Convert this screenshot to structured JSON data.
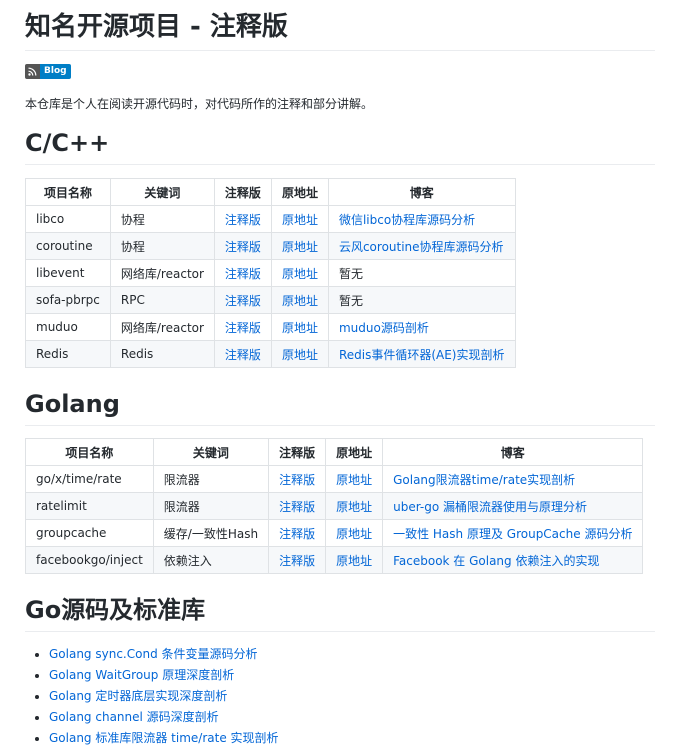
{
  "page": {
    "title": "知名开源项目 - 注释版",
    "badge_label": "Blog",
    "intro": "本仓库是个人在阅读开源代码时，对代码所作的注释和部分讲解。"
  },
  "sections": {
    "cpp": {
      "heading": "C/C++",
      "headers": [
        "项目名称",
        "关键词",
        "注释版",
        "原地址",
        "博客"
      ],
      "rows": [
        [
          "libco",
          "协程",
          "注释版",
          "原地址",
          "微信libco协程库源码分析"
        ],
        [
          "coroutine",
          "协程",
          "注释版",
          "原地址",
          "云风coroutine协程库源码分析"
        ],
        [
          "libevent",
          "网络库/reactor",
          "注释版",
          "原地址",
          "暂无"
        ],
        [
          "sofa-pbrpc",
          "RPC",
          "注释版",
          "原地址",
          "暂无"
        ],
        [
          "muduo",
          "网络库/reactor",
          "注释版",
          "原地址",
          "muduo源码剖析"
        ],
        [
          "Redis",
          "Redis",
          "注释版",
          "原地址",
          "Redis事件循环器(AE)实现剖析"
        ]
      ]
    },
    "golang": {
      "heading": "Golang",
      "headers": [
        "项目名称",
        "关键词",
        "注释版",
        "原地址",
        "博客"
      ],
      "rows": [
        [
          "go/x/time/rate",
          "限流器",
          "注释版",
          "原地址",
          "Golang限流器time/rate实现剖析"
        ],
        [
          "ratelimit",
          "限流器",
          "注释版",
          "原地址",
          "uber-go 漏桶限流器使用与原理分析"
        ],
        [
          "groupcache",
          "缓存/一致性Hash",
          "注释版",
          "原地址",
          "一致性 Hash 原理及 GroupCache 源码分析"
        ],
        [
          "facebookgo/inject",
          "依赖注入",
          "注释版",
          "原地址",
          "Facebook 在 Golang 依赖注入的实现"
        ]
      ]
    },
    "gostd": {
      "heading": "Go源码及标准库",
      "items": [
        "Golang sync.Cond 条件变量源码分析",
        "Golang WaitGroup 原理深度剖析",
        "Golang 定时器底层实现深度剖析",
        "Golang channel 源码深度剖析",
        "Golang 标准库限流器 time/rate 实现剖析"
      ]
    }
  },
  "colors": {
    "link": "#0366d6",
    "text": "#24292e",
    "border": "#dfe2e5",
    "stripe": "#f6f8fa",
    "badge_left": "#555555",
    "badge_right": "#007ec6"
  },
  "icons": {
    "badge_icon": "rss-icon"
  }
}
